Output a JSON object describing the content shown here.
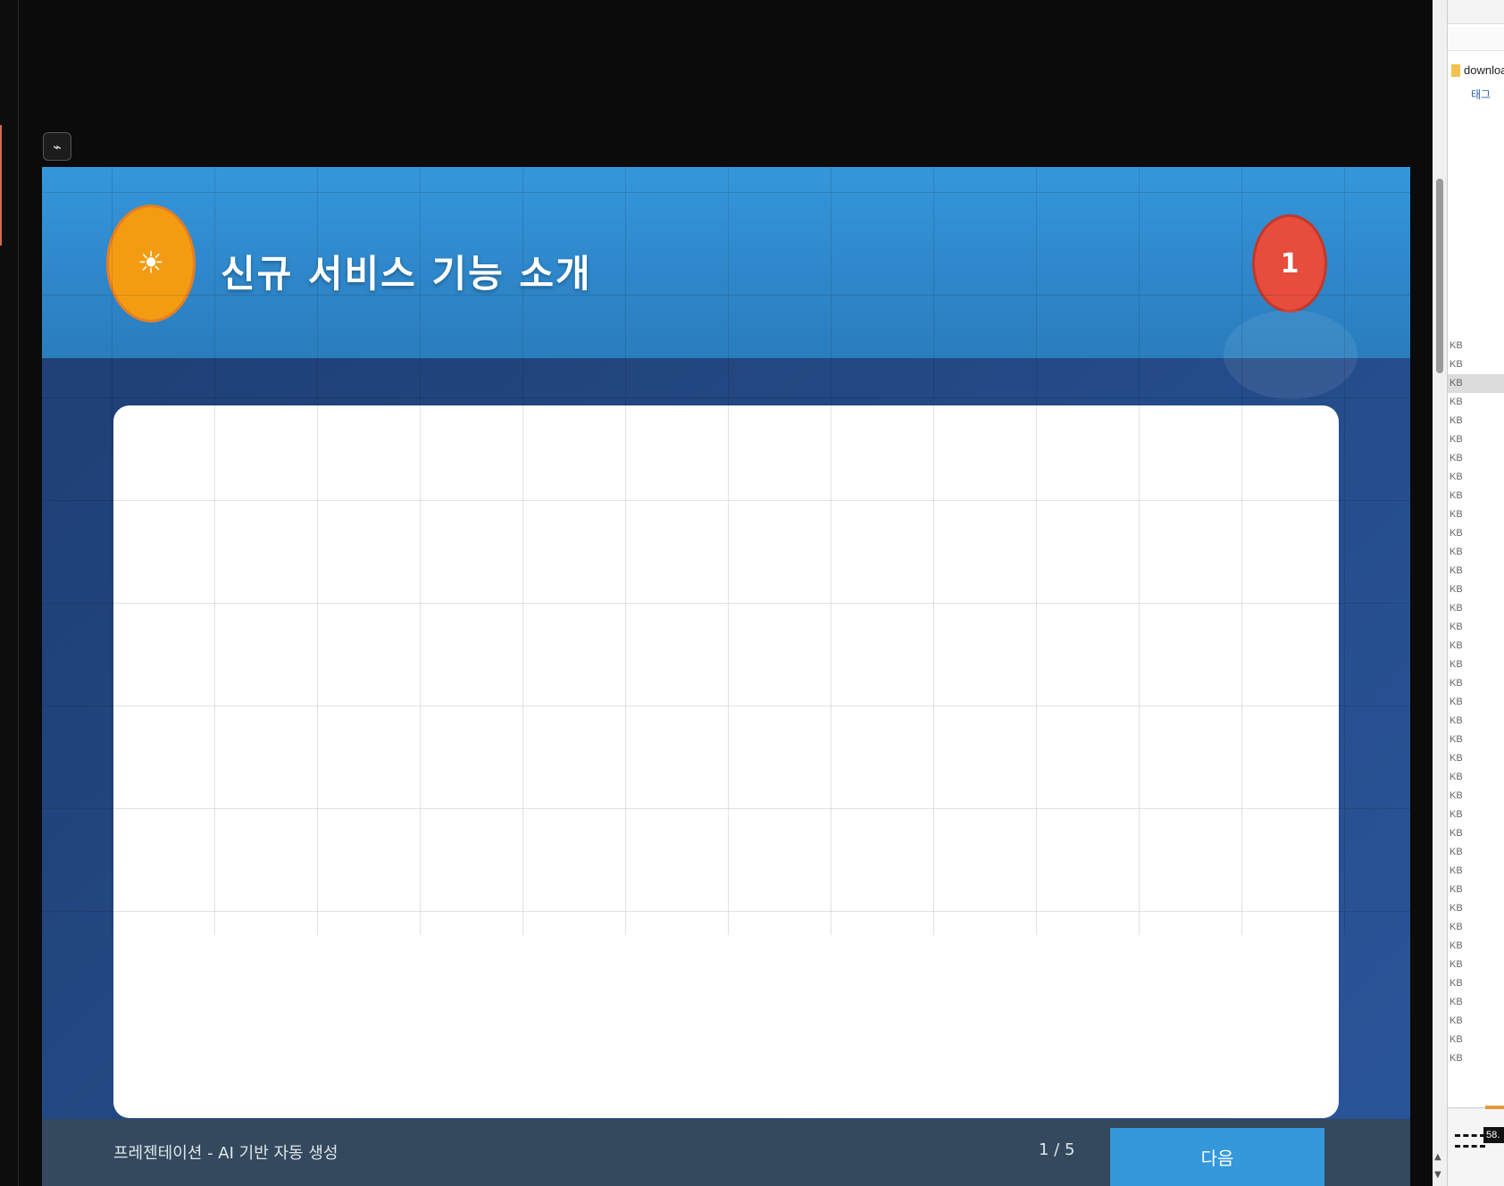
{
  "toolbar": {
    "icon": "copilot-icon"
  },
  "slide": {
    "title": "신규 서비스 기능 소개",
    "page_badge": "1",
    "sun_icon": "☀",
    "colors": {
      "header": "#3498db",
      "background": "#234a86",
      "sun_badge": "#f39c12",
      "page_badge": "#e74c3c",
      "footer": "#34495e",
      "button": "#3498db"
    }
  },
  "footer": {
    "text": "프레젠테이션 - AI 기반 자동 생성",
    "page_indicator": "1 / 5",
    "button_label": "다음"
  },
  "file_panel": {
    "path": "downloa",
    "tag": "태그",
    "size_unit": "KB",
    "rows": [
      "KB",
      "KB",
      "KB",
      "KB",
      "KB",
      "KB",
      "KB",
      "KB",
      "KB",
      "KB",
      "KB",
      "KB",
      "KB",
      "KB",
      "KB",
      "KB",
      "KB",
      "KB",
      "KB",
      "KB",
      "KB",
      "KB",
      "KB",
      "KB",
      "KB",
      "KB",
      "KB",
      "KB",
      "KB",
      "KB",
      "KB",
      "KB",
      "KB",
      "KB",
      "KB",
      "KB",
      "KB",
      "KB",
      "KB"
    ],
    "selected_row": 2,
    "badge": "58."
  }
}
